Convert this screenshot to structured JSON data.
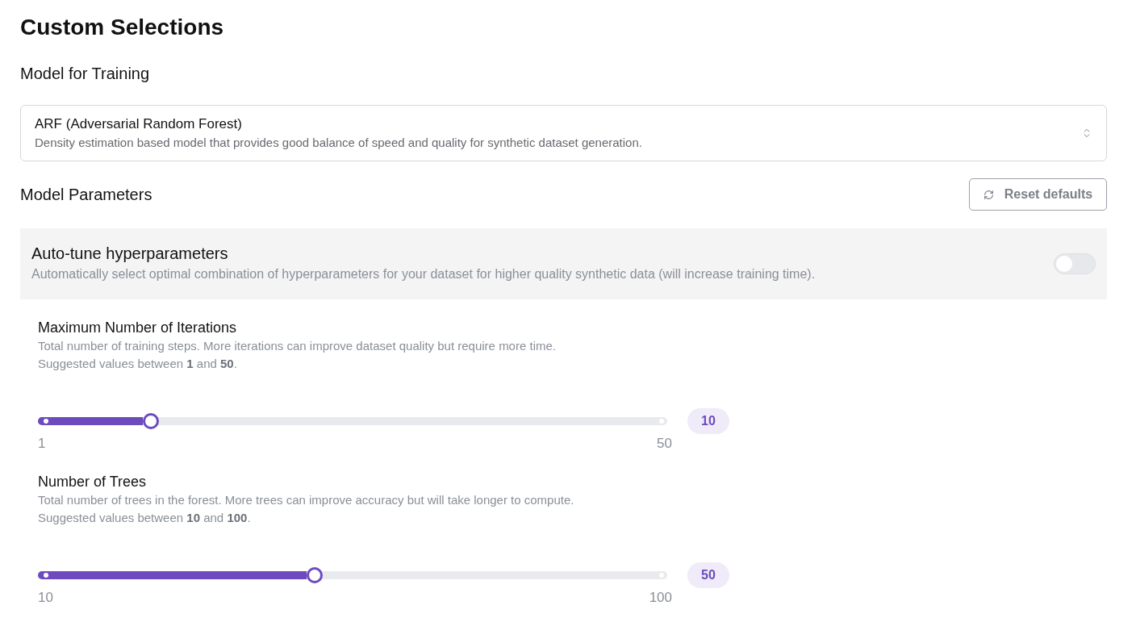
{
  "title": "Custom Selections",
  "model_section": {
    "heading": "Model for Training",
    "select": {
      "value": "ARF (Adversarial Random Forest)",
      "description": "Density estimation based model that provides good balance of speed and quality for synthetic dataset generation."
    }
  },
  "parameters_section": {
    "heading": "Model Parameters",
    "reset_button": "Reset defaults",
    "auto_tune": {
      "label": "Auto-tune hyperparameters",
      "description": "Automatically select optimal combination of hyperparameters for your dataset for higher quality synthetic data (will increase training time).",
      "on": false
    },
    "parameters": [
      {
        "name": "Maximum Number of Iterations",
        "description": "Total number of training steps. More iterations can improve dataset quality but require more time.",
        "hint": "Suggested values between **1** and **50**.",
        "level": 0.18,
        "min_label": "1",
        "max_label": "50",
        "value": "10"
      },
      {
        "name": "Number of Trees",
        "description": "Total number of trees in the forest. More trees can improve accuracy but will take longer to compute.",
        "hint": "Suggested values between **10** and **100**.",
        "level": 0.44,
        "min_label": "10",
        "max_label": "100",
        "value": "50"
      }
    ]
  }
}
